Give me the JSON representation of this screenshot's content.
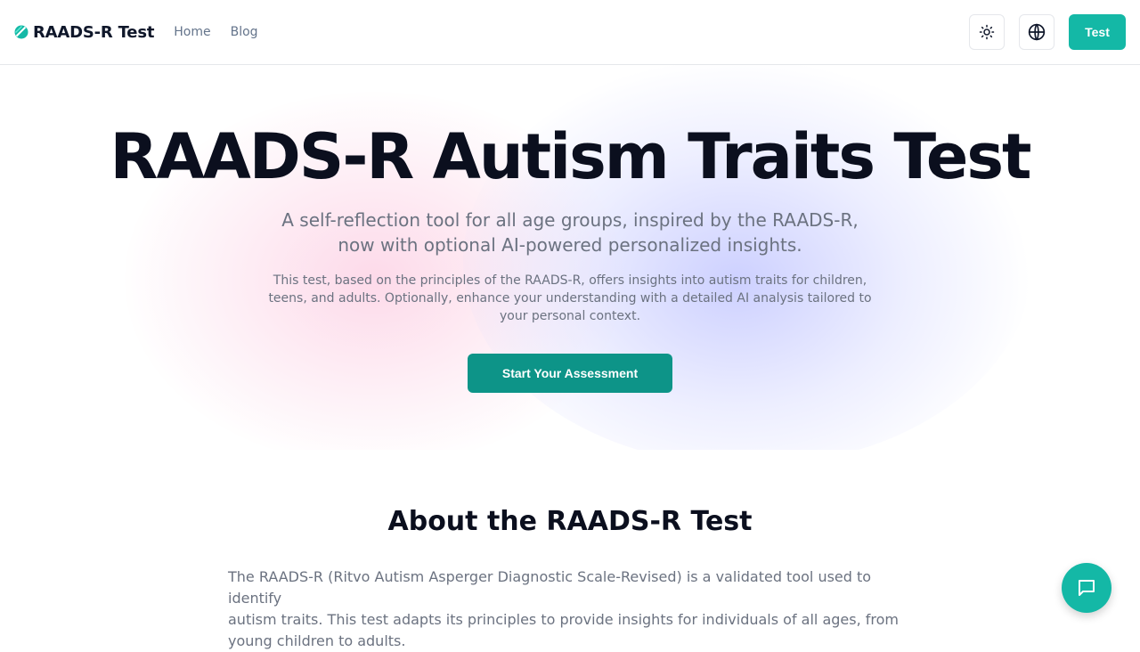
{
  "header": {
    "brand": "RAADS-R Test",
    "nav": [
      "Home",
      "Blog"
    ],
    "theme_icon": "sun-icon",
    "language_icon": "globe-icon",
    "test_button": "Test"
  },
  "hero": {
    "title": "RAADS-R Autism Traits Test",
    "subtitle_line1": "A self-reflection tool for all age groups, inspired by the RAADS-R,",
    "subtitle_line2": "now with optional AI-powered personalized insights.",
    "desc_line1": "This test, based on the principles of the RAADS-R, offers insights into autism traits for children,",
    "desc_line2": "teens, and adults. Optionally, enhance your understanding with a detailed AI analysis tailored to",
    "desc_line3": "your personal context.",
    "cta": "Start Your Assessment"
  },
  "about": {
    "title": "About the RAADS-R Test",
    "line1": "The RAADS-R (Ritvo Autism Asperger Diagnostic Scale-Revised) is a validated tool used to identify",
    "line2": "autism traits. This test adapts its principles to provide insights for individuals of all ages, from",
    "line3": "young children to adults."
  },
  "chat": {
    "icon": "chat-bubble-icon"
  },
  "colors": {
    "accent": "#14b8a6",
    "cta": "#0d9488",
    "text_dark": "#0b0f1e",
    "text_muted": "#6b7280"
  }
}
